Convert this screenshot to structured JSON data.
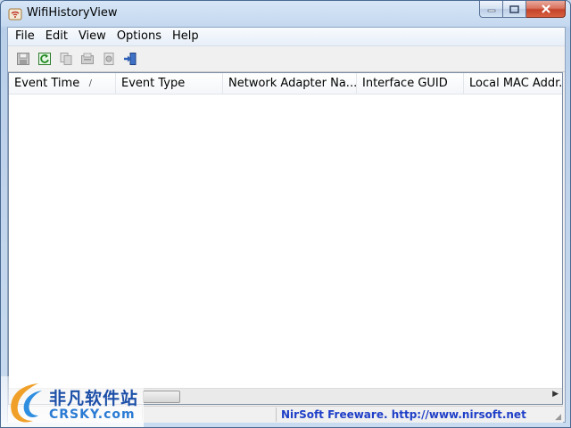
{
  "window": {
    "title": "WifiHistoryView"
  },
  "menu": [
    {
      "label": "File"
    },
    {
      "label": "Edit"
    },
    {
      "label": "View"
    },
    {
      "label": "Options"
    },
    {
      "label": "Help"
    }
  ],
  "toolbar": {
    "buttons": [
      {
        "icon": "save-icon"
      },
      {
        "icon": "refresh-icon"
      },
      {
        "icon": "copy-icon"
      },
      {
        "icon": "properties-icon"
      },
      {
        "icon": "html-report-icon"
      },
      {
        "icon": "exit-icon"
      }
    ]
  },
  "table": {
    "columns": [
      {
        "label": "Event Time"
      },
      {
        "label": "Event Type"
      },
      {
        "label": "Network Adapter Na..."
      },
      {
        "label": "Interface GUID"
      },
      {
        "label": "Local MAC Addr..."
      }
    ],
    "sort_indicator": "/",
    "rows": []
  },
  "status": {
    "link_text": "NirSoft Freeware.  http://www.nirsoft.net"
  },
  "watermark": {
    "brand_cn": "非凡软件站",
    "brand_en": "CRSKY.com"
  },
  "colors": {
    "status_link": "#1f3fc8",
    "close_button": "#c4432a"
  }
}
